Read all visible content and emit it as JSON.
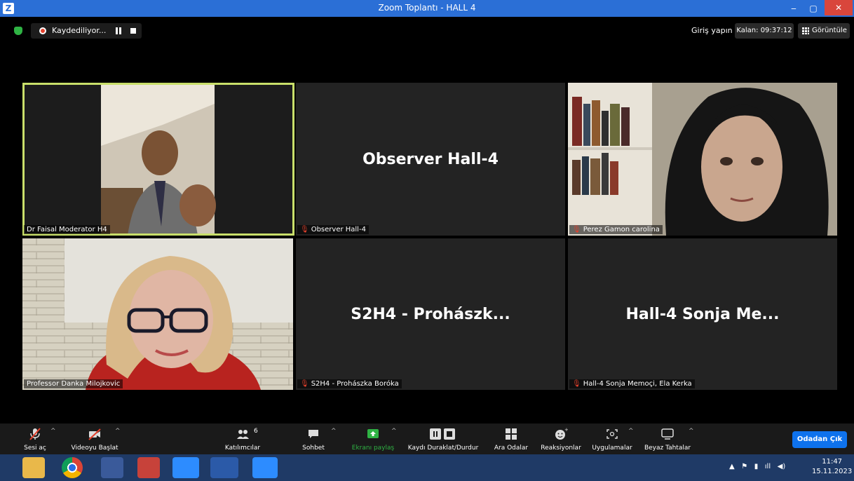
{
  "window": {
    "title": "Zoom Toplantı - HALL 4",
    "app_letter": "Z"
  },
  "topbar": {
    "recording_label": "Kaydediliyor...",
    "login_label": "Giriş yapın",
    "remaining_label": "Kalan: 09:37:12",
    "view_label": "Görüntüle"
  },
  "tiles": [
    {
      "name": "Dr Faisal Moderator H4",
      "muted": false,
      "video": true,
      "active": true
    },
    {
      "name": "Observer Hall-4",
      "display": "Observer Hall-4",
      "muted": true,
      "video": false
    },
    {
      "name": "Perez Gamon carolina",
      "muted": true,
      "video": true
    },
    {
      "name": "Professor Danka Milojkovic",
      "muted": false,
      "video": true
    },
    {
      "name": "S2H4 - Prohászka Boróka",
      "display": "S2H4 - Prohászk...",
      "muted": true,
      "video": false
    },
    {
      "name": "Hall-4 Sonja Memoçi, Ela Kerka",
      "display": "Hall-4 Sonja Me...",
      "muted": true,
      "video": false
    }
  ],
  "toolbar": {
    "unmute": "Sesi aç",
    "start_video": "Videoyu Başlat",
    "participants": "Katılımcılar",
    "participants_count": "6",
    "chat": "Sohbet",
    "share": "Ekranı paylaş",
    "record": "Kaydı Duraklat/Durdur",
    "breakout": "Ara Odalar",
    "reactions": "Reaksiyonlar",
    "apps": "Uygulamalar",
    "whiteboards": "Beyaz Tahtalar",
    "leave": "Odadan Çık"
  },
  "taskbar": {
    "time": "11:47",
    "date": "15.11.2023"
  },
  "colors": {
    "active_speaker": "#c9df6a",
    "leave_button": "#0e72ed",
    "share_green": "#2fb344",
    "muted_red": "#e4412d"
  }
}
